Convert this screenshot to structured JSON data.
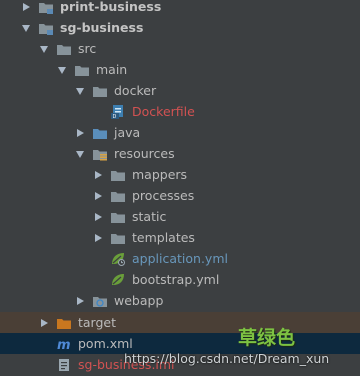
{
  "tree": {
    "print_business": "print-business",
    "sg_business": "sg-business",
    "src": "src",
    "main": "main",
    "docker": "docker",
    "dockerfile": "Dockerfile",
    "java": "java",
    "resources": "resources",
    "mappers": "mappers",
    "processes": "processes",
    "static": "static",
    "templates": "templates",
    "application_yml": "application.yml",
    "bootstrap_yml": "bootstrap.yml",
    "webapp": "webapp",
    "target": "target",
    "pom_xml": "pom.xml",
    "sg_business_iml": "sg-business.iml"
  },
  "overlay": {
    "watermark": "https://blog.csdn.net/Dream_xun",
    "stamp": "草绿色"
  },
  "colors": {
    "background": "#3c3f41",
    "selected_row": "#4a3f36",
    "current_row": "#0d293e",
    "folder": "#87939a",
    "source_folder": "#5a8ebb",
    "target_folder": "#c9771f",
    "modified_file": "#d25252",
    "config_file": "#6897bb",
    "stamp_text": "#7dc242"
  },
  "icons": {
    "folder": "folder-icon",
    "module": "module-folder-icon",
    "source_root": "source-root-icon",
    "resources_root": "resources-root-icon",
    "web": "web-folder-icon",
    "excluded": "excluded-folder-icon",
    "docker_file": "docker-file-icon",
    "spring_yml": "spring-leaf-icon",
    "maven": "maven-icon",
    "iml": "iml-file-icon"
  }
}
